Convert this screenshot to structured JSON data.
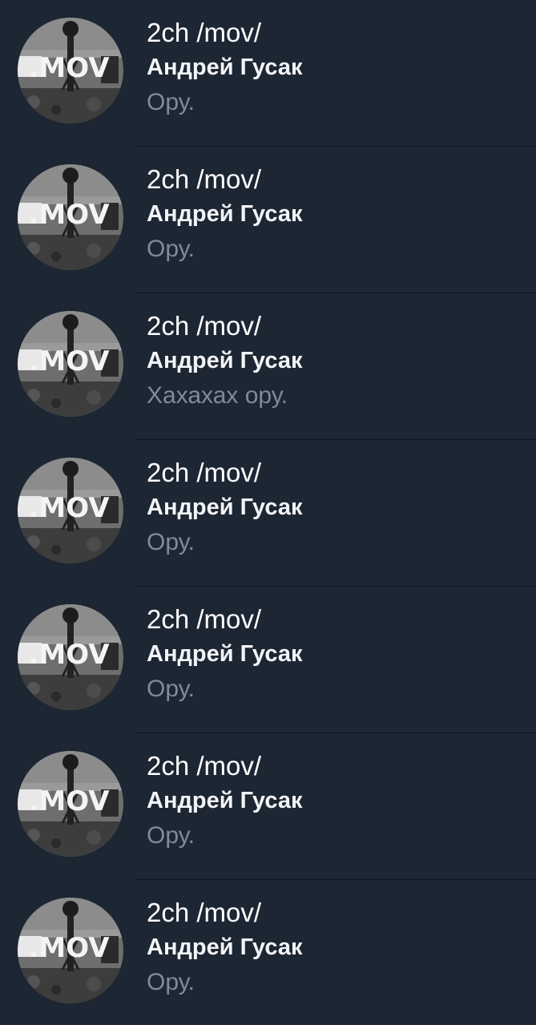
{
  "chats": [
    {
      "title": "2ch /mov/",
      "sender": "Андрей Гусак",
      "message": "Ору."
    },
    {
      "title": "2ch /mov/",
      "sender": "Андрей Гусак",
      "message": "Ору."
    },
    {
      "title": "2ch /mov/",
      "sender": "Андрей Гусак",
      "message": "Хахахах ору."
    },
    {
      "title": "2ch /mov/",
      "sender": "Андрей Гусак",
      "message": "Ору."
    },
    {
      "title": "2ch /mov/",
      "sender": "Андрей Гусак",
      "message": "Ору."
    },
    {
      "title": "2ch /mov/",
      "sender": "Андрей Гусак",
      "message": "Ору."
    },
    {
      "title": "2ch /mov/",
      "sender": "Андрей Гусак",
      "message": "Ору."
    }
  ],
  "avatar": {
    "logo_text": ".MOV"
  },
  "colors": {
    "background": "#1d2633",
    "title": "#ffffff",
    "sender": "#f2f4f7",
    "message": "#7d8b9b",
    "divider": "#0f151d"
  }
}
